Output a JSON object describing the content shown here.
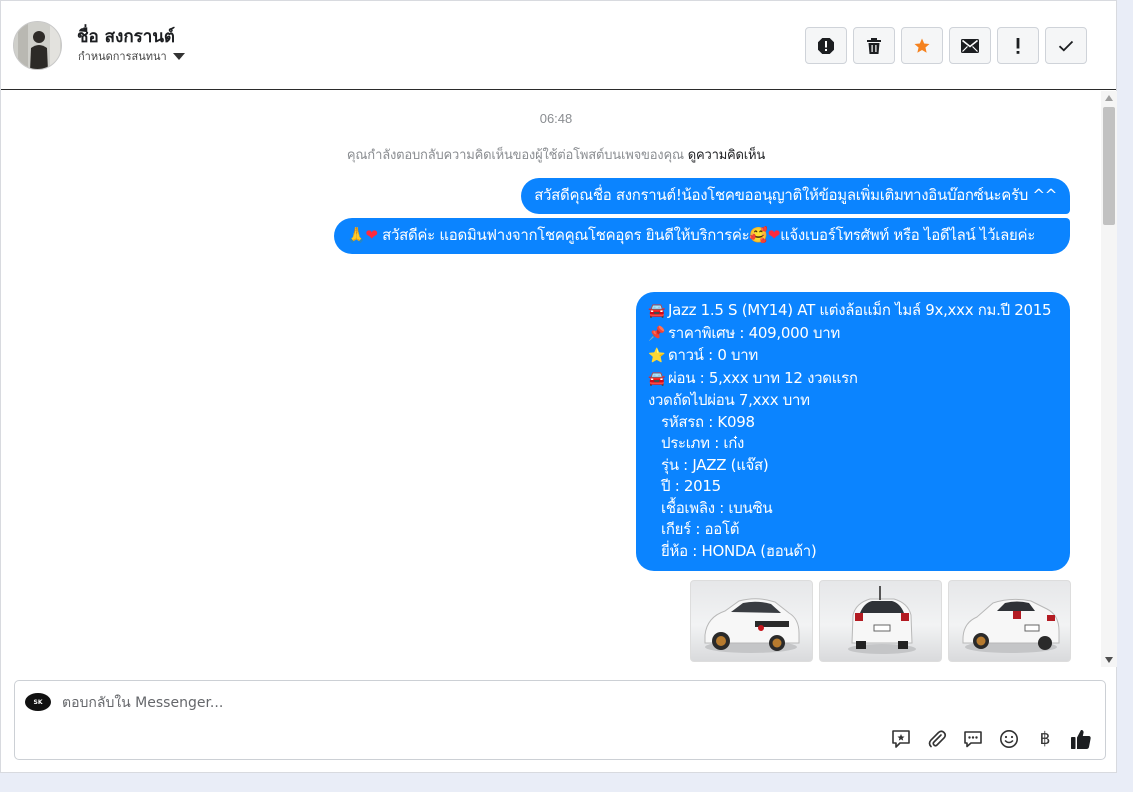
{
  "header": {
    "contact_name": "ชื่อ สงกรานต์",
    "assign_label": "กำหนดการสนทนา",
    "toolbar": [
      {
        "name": "spam-button",
        "icon": "alert-circle-icon"
      },
      {
        "name": "delete-button",
        "icon": "trash-icon"
      },
      {
        "name": "star-button",
        "icon": "star-icon"
      },
      {
        "name": "mark-unread-button",
        "icon": "envelope-icon"
      },
      {
        "name": "follow-up-button",
        "icon": "exclamation-icon"
      },
      {
        "name": "mark-done-button",
        "icon": "check-icon"
      }
    ],
    "star_color": "#f5821f"
  },
  "chat": {
    "timestamp": "06:48",
    "notice_text": "คุณกำลังตอบกลับความคิดเห็นของผู้ใช้ต่อโพสต์บนเพจของคุณ",
    "notice_link": "ดูความคิดเห็น",
    "bubble_color": "#0b84ff",
    "message1": "สวัสดีคุณชื่อ สงกรานต์!น้องโชคขออนุญาติให้ข้อมูลเพิ่มเติมทางอินบ๊อกซ์นะครับ ^^",
    "message2": {
      "emoji1": "🙏",
      "emoji2": "❤",
      "text1": "สวัสดีค่ะ แอดมินฟางจากโชคคูณโชคอุดร ยินดีให้บริการค่ะ",
      "emoji3": "🥰",
      "emoji4": "❤",
      "text2": "แจ้งเบอร์โทรศัพท์ หรือ ไอดีไลน์  ไว้เลยค่ะ"
    },
    "message3": {
      "l1_emoji": "🚘",
      "l1": "Jazz 1.5 S (MY14) AT แต่งล้อแม็ก ไมล์ 9x,xxx กม.ปี 2015",
      "l2_emoji": "📌",
      "l2": "ราคาพิเศษ : 409,000 บาท",
      "l3_emoji": "⭐",
      "l3": "ดาวน์ : 0 บาท",
      "l4_emoji": "🚘",
      "l4": "ผ่อน : 5,xxx บาท 12 งวดแรก",
      "l5": "งวดถัดไปผ่อน  7,xxx บาท",
      "l6": "รหัสรถ : K098",
      "l7": "ประเภท : เก๋ง",
      "l8": "รุ่น : JAZZ (แจ๊ส)",
      "l9": "ปี : 2015",
      "l10": "เชื้อเพลิง : เบนซิน",
      "l11": "เกียร์ : ออโต้",
      "l12": "ยี่ห้อ : HONDA (ฮอนด้า)"
    },
    "photos": [
      {
        "icon": "white-car-front-photo"
      },
      {
        "icon": "white-car-rear-photo"
      },
      {
        "icon": "white-car-rear-angle-photo"
      }
    ]
  },
  "composer": {
    "placeholder": "ตอบกลับใน Messenger...",
    "page_logo_text": "SK",
    "tools": [
      {
        "name": "saved-reply-button",
        "icon": "saved-reply-icon"
      },
      {
        "name": "attach-button",
        "icon": "paperclip-icon"
      },
      {
        "name": "quick-reply-button",
        "icon": "speech-bubbles-icon"
      },
      {
        "name": "emoji-button",
        "icon": "smiley-icon"
      },
      {
        "name": "payment-button",
        "icon": "baht-icon",
        "glyph": "฿"
      },
      {
        "name": "like-button",
        "icon": "thumbs-up-icon"
      }
    ]
  }
}
